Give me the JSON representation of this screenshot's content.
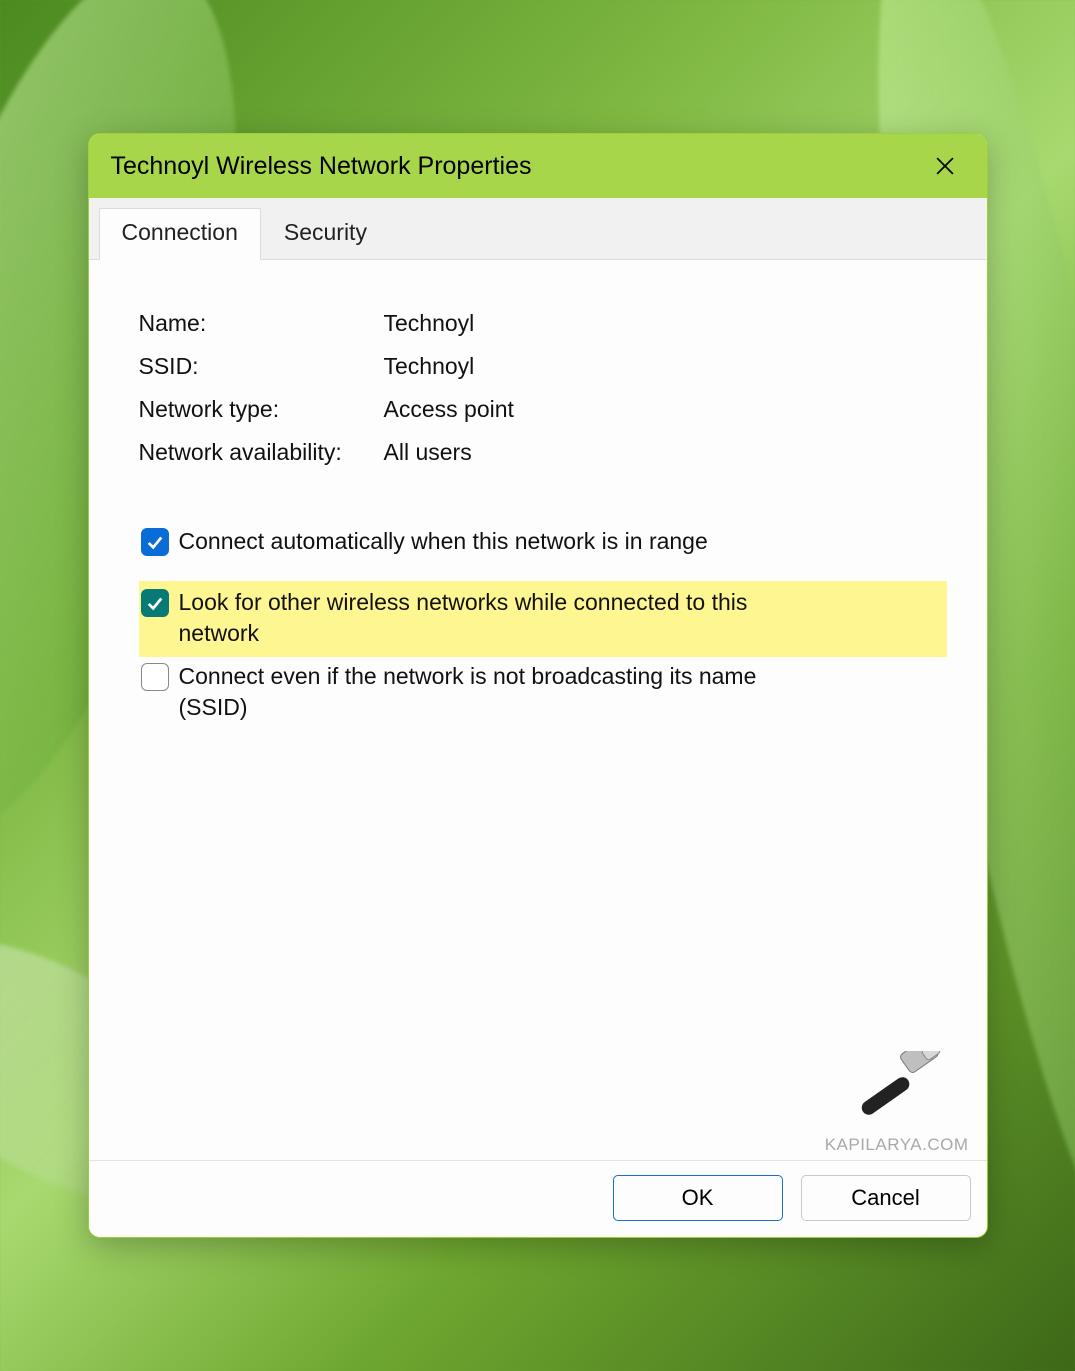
{
  "window": {
    "title": "Technoyl Wireless Network Properties"
  },
  "tabs": {
    "connection": "Connection",
    "security": "Security"
  },
  "fields": {
    "name_label": "Name:",
    "name_value": "Technoyl",
    "ssid_label": "SSID:",
    "ssid_value": "Technoyl",
    "type_label": "Network type:",
    "type_value": "Access point",
    "avail_label": "Network availability:",
    "avail_value": "All users"
  },
  "checkboxes": {
    "auto_connect": "Connect automatically when this network is in range",
    "look_other": "Look for other wireless networks while connected to this network",
    "connect_hidden": "Connect even if the network is not broadcasting its name (SSID)"
  },
  "buttons": {
    "ok": "OK",
    "cancel": "Cancel"
  },
  "watermark": "KAPILARYA.COM"
}
